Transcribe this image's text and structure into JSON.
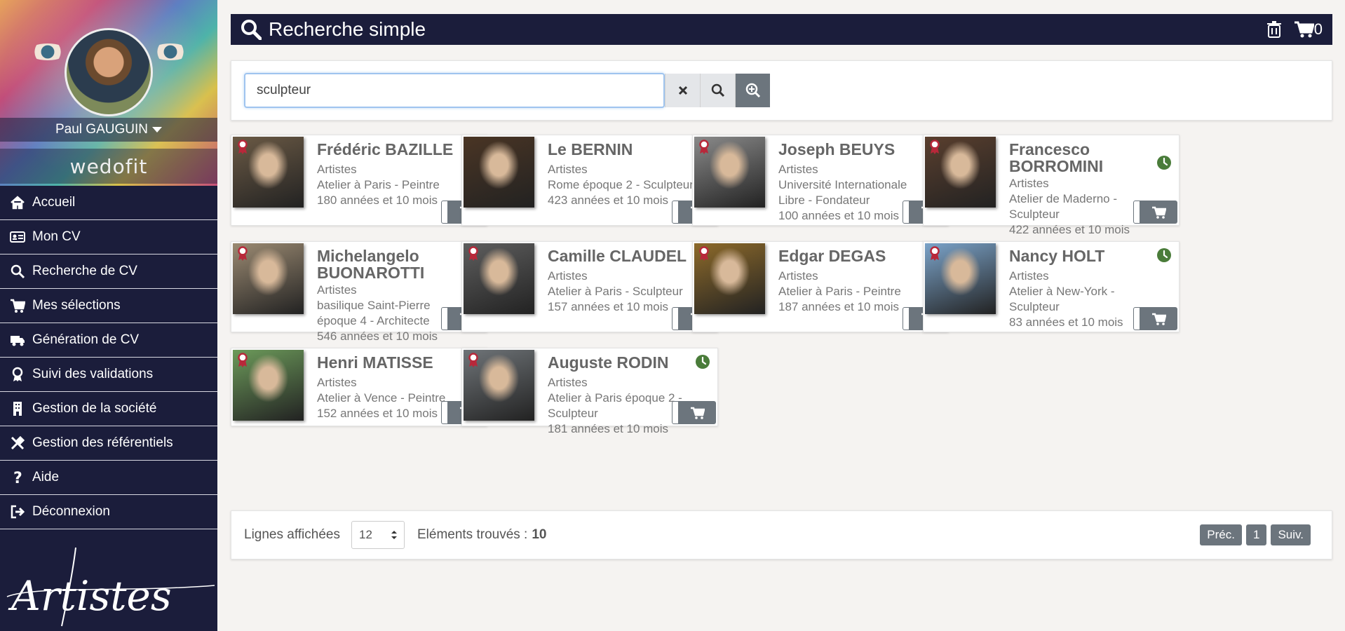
{
  "sidebar": {
    "user_name": "Paul GAUGUIN",
    "logo_text": "wedofit",
    "brand_text": "Artistes",
    "items": [
      {
        "label": "Accueil",
        "icon": "home-icon"
      },
      {
        "label": "Mon CV",
        "icon": "id-card-icon"
      },
      {
        "label": "Recherche de CV",
        "icon": "search-icon"
      },
      {
        "label": "Mes sélections",
        "icon": "cart-icon"
      },
      {
        "label": "Génération de CV",
        "icon": "truck-icon"
      },
      {
        "label": "Suivi des validations",
        "icon": "award-icon"
      },
      {
        "label": "Gestion de la société",
        "icon": "building-icon"
      },
      {
        "label": "Gestion des référentiels",
        "icon": "tools-icon"
      },
      {
        "label": "Aide",
        "icon": "question-icon"
      },
      {
        "label": "Déconnexion",
        "icon": "sign-out-icon"
      }
    ]
  },
  "header": {
    "title": "Recherche simple",
    "cart_count": "0"
  },
  "search": {
    "value": "sculpteur"
  },
  "cards": [
    {
      "name": "Frédéric BAZILLE",
      "category": "Artistes",
      "lines": [
        "Atelier à Paris - Peintre",
        "180 années et 10 mois"
      ],
      "badge": true,
      "photo": "#6b5a45"
    },
    {
      "name": "Le BERNIN",
      "category": "Artistes",
      "lines": [
        "Rome époque 2 - Sculpteur",
        "423 années et 10 mois"
      ],
      "badge": false,
      "photo": "#4a3524"
    },
    {
      "name": "Joseph BEUYS",
      "category": "Artistes",
      "lines": [
        "Université Internationale",
        "Libre - Fondateur",
        "100 années et 10 mois"
      ],
      "badge": true,
      "photo": "#8a8a8a"
    },
    {
      "name": "Francesco BORROMINI",
      "category": "Artistes",
      "lines": [
        "Atelier de Maderno -",
        "Sculpteur",
        "422 années et 10 mois"
      ],
      "badge": true,
      "photo": "#5a3f2e"
    },
    {
      "name": "Michelangelo BUONAROTTI",
      "category": "Artistes",
      "lines": [
        "basilique Saint-Pierre",
        "époque 4 - Architecte",
        "546 années et 10 mois"
      ],
      "badge": true,
      "photo": "#9b8a72"
    },
    {
      "name": "Camille CLAUDEL",
      "category": "Artistes",
      "lines": [
        "Atelier à Paris - Sculpteur",
        "157 années et 10 mois"
      ],
      "badge": true,
      "photo": "#5e5e5e"
    },
    {
      "name": "Edgar DEGAS",
      "category": "Artistes",
      "lines": [
        "Atelier à Paris - Peintre",
        "187 années et 10 mois"
      ],
      "badge": true,
      "photo": "#8d6a2a"
    },
    {
      "name": "Nancy HOLT",
      "category": "Artistes",
      "lines": [
        "Atelier à New-York -",
        "Sculpteur",
        "83 années et 10 mois"
      ],
      "badge": true,
      "photo": "#7ba3c9"
    },
    {
      "name": "Henri MATISSE",
      "category": "Artistes",
      "lines": [
        "Atelier à Vence - Peintre",
        "152 années et 10 mois"
      ],
      "badge": true,
      "photo": "#6c9a5a"
    },
    {
      "name": "Auguste RODIN",
      "category": "Artistes",
      "lines": [
        "Atelier à Paris époque 2 -",
        "Sculpteur",
        "181 années et 10 mois"
      ],
      "badge": true,
      "photo": "#6f7478"
    }
  ],
  "footer": {
    "rows_label": "Lignes affichées",
    "rows_value": "12",
    "found_label": "Eléments trouvés :",
    "found_count": "10",
    "prev": "Préc.",
    "page": "1",
    "next": "Suiv."
  },
  "colors": {
    "navy": "#1b1d3b",
    "clock_green": "#4a7c3a",
    "badge_red": "#b8283a",
    "button_gray": "#6c757d"
  }
}
